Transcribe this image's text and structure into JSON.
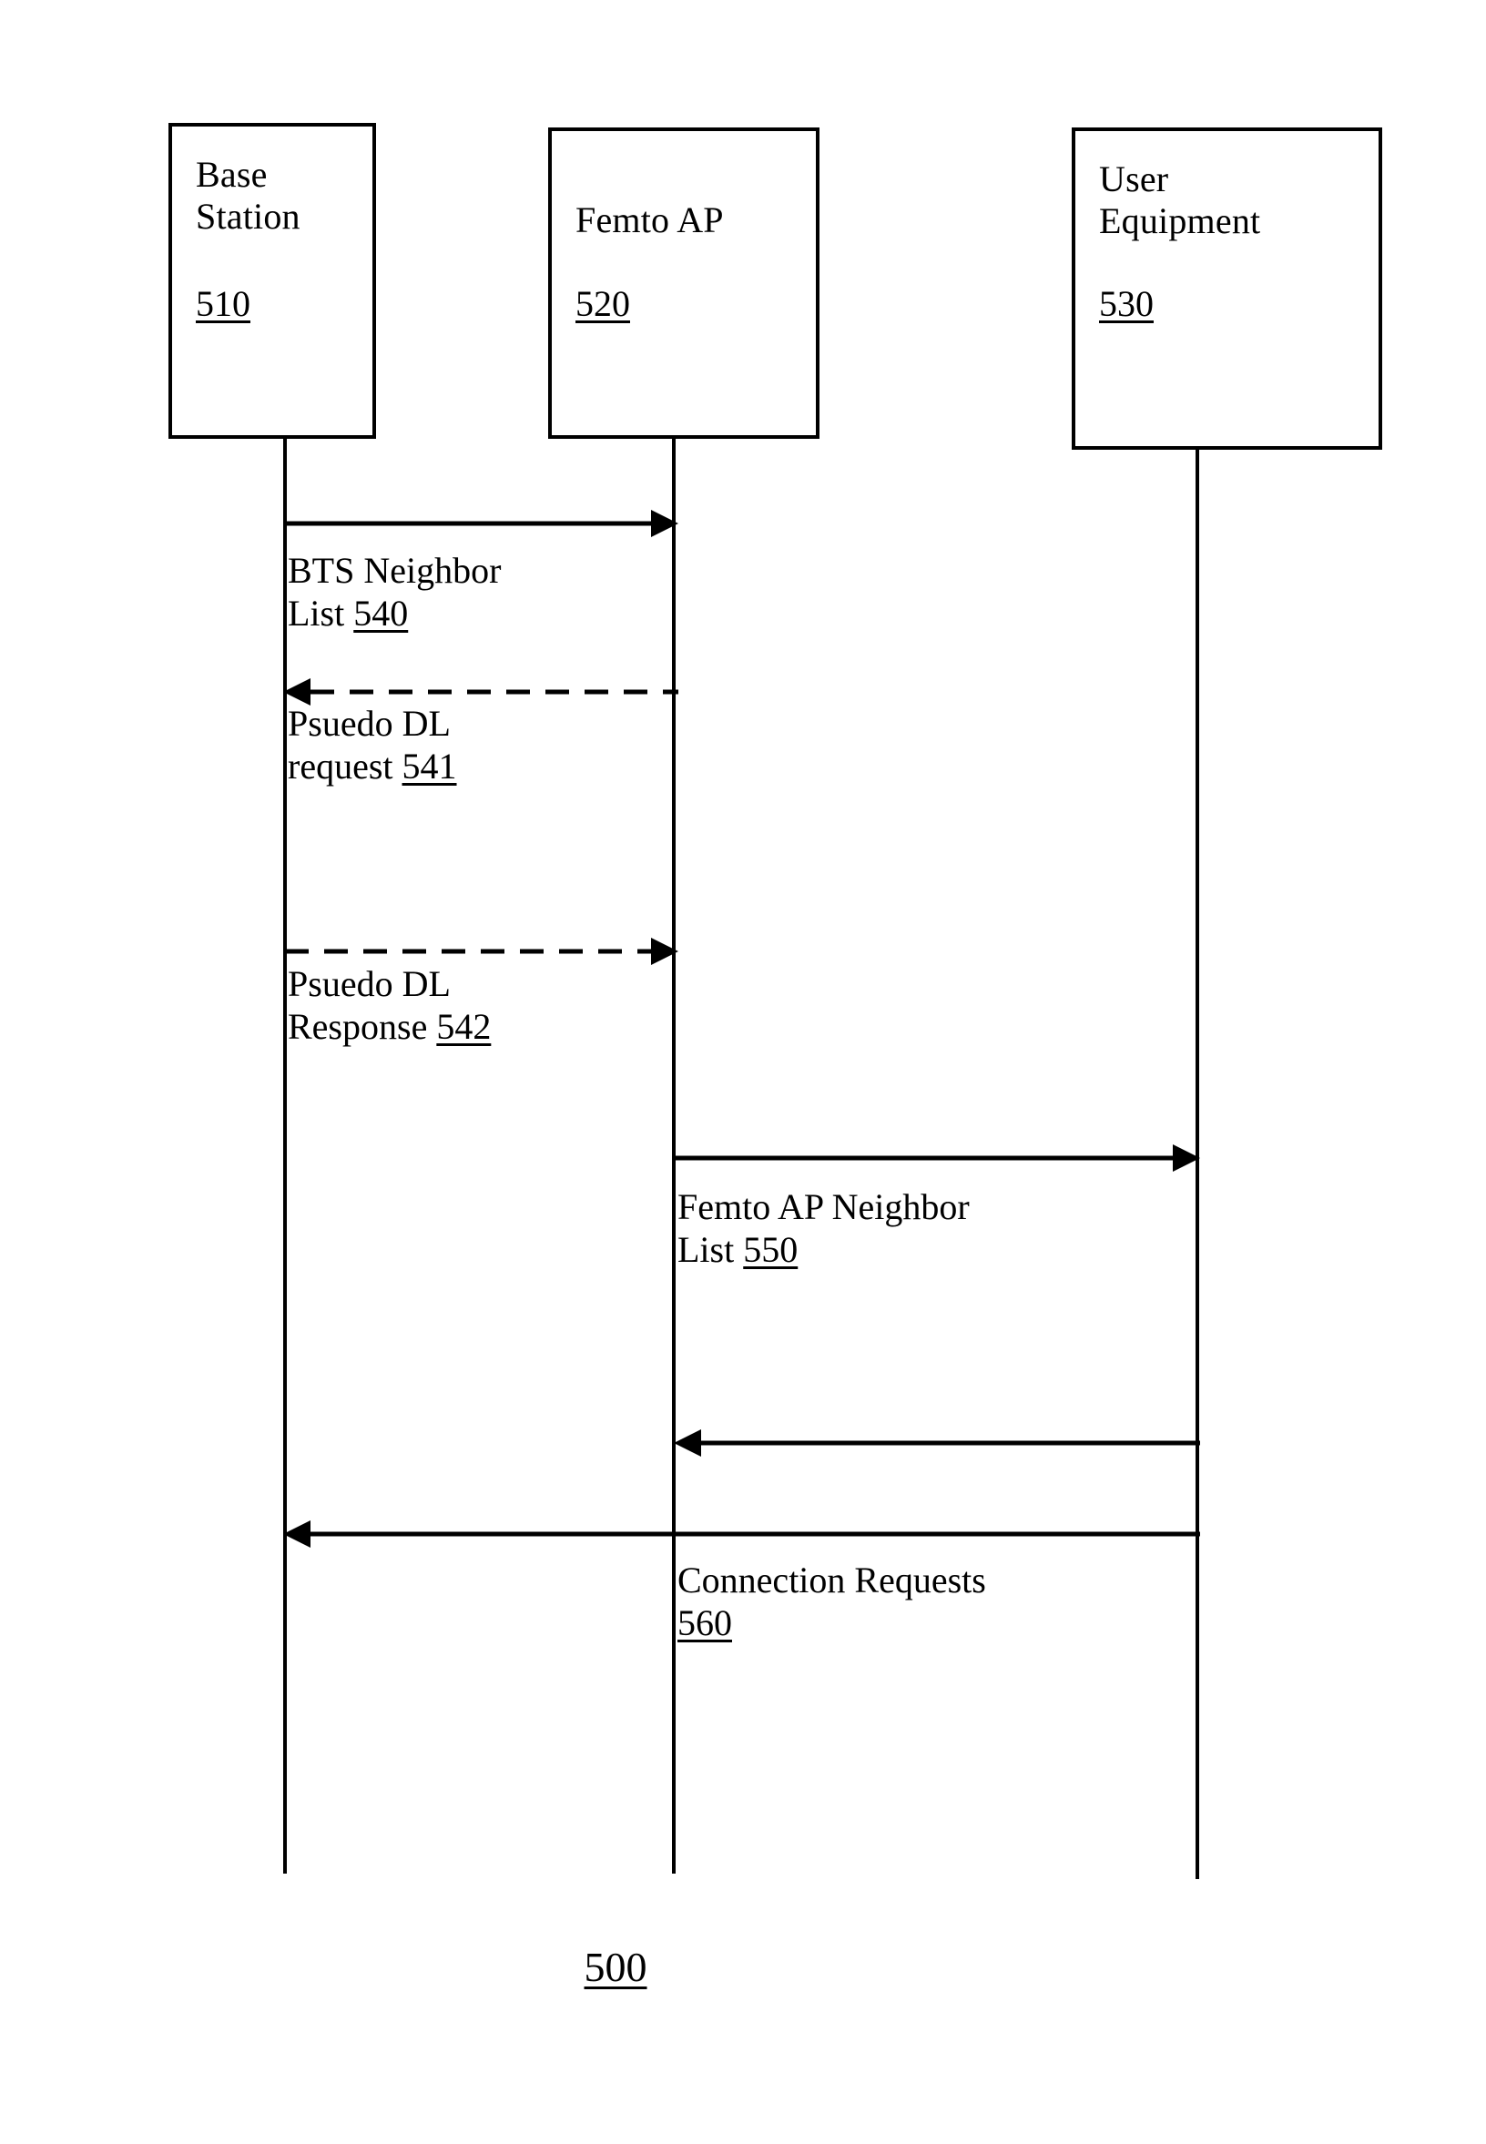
{
  "figure": {
    "number": "500",
    "type": "sequence-diagram"
  },
  "participants": [
    {
      "id": "base-station",
      "title": "Base\nStation",
      "ref": "510"
    },
    {
      "id": "femto-ap",
      "title": "Femto AP",
      "ref": "520"
    },
    {
      "id": "user-equipment",
      "title": "User\nEquipment",
      "ref": "530"
    }
  ],
  "messages": [
    {
      "id": "540",
      "label_text": "BTS Neighbor\nList ",
      "ref": "540",
      "from": "base-station",
      "to": "femto-ap",
      "direction": "right",
      "line_style": "solid"
    },
    {
      "id": "541",
      "label_text": "Psuedo DL\nrequest ",
      "ref": "541",
      "from": "femto-ap",
      "to": "base-station",
      "direction": "left",
      "line_style": "dashed"
    },
    {
      "id": "542",
      "label_text": "Psuedo DL\nResponse ",
      "ref": "542",
      "from": "base-station",
      "to": "femto-ap",
      "direction": "right",
      "line_style": "dashed"
    },
    {
      "id": "550",
      "label_text": "Femto AP Neighbor\nList ",
      "ref": "550",
      "from": "femto-ap",
      "to": "user-equipment",
      "direction": "right",
      "line_style": "solid"
    },
    {
      "id": "unlabeled-ue-to-femto",
      "label_text": "",
      "ref": "",
      "from": "user-equipment",
      "to": "femto-ap",
      "direction": "left",
      "line_style": "solid"
    },
    {
      "id": "560",
      "label_text": "Connection Requests\n",
      "ref": "560",
      "from": "user-equipment",
      "to": "base-station",
      "direction": "left",
      "line_style": "solid"
    }
  ],
  "colors": {
    "ink": "#000000",
    "background": "#ffffff"
  }
}
